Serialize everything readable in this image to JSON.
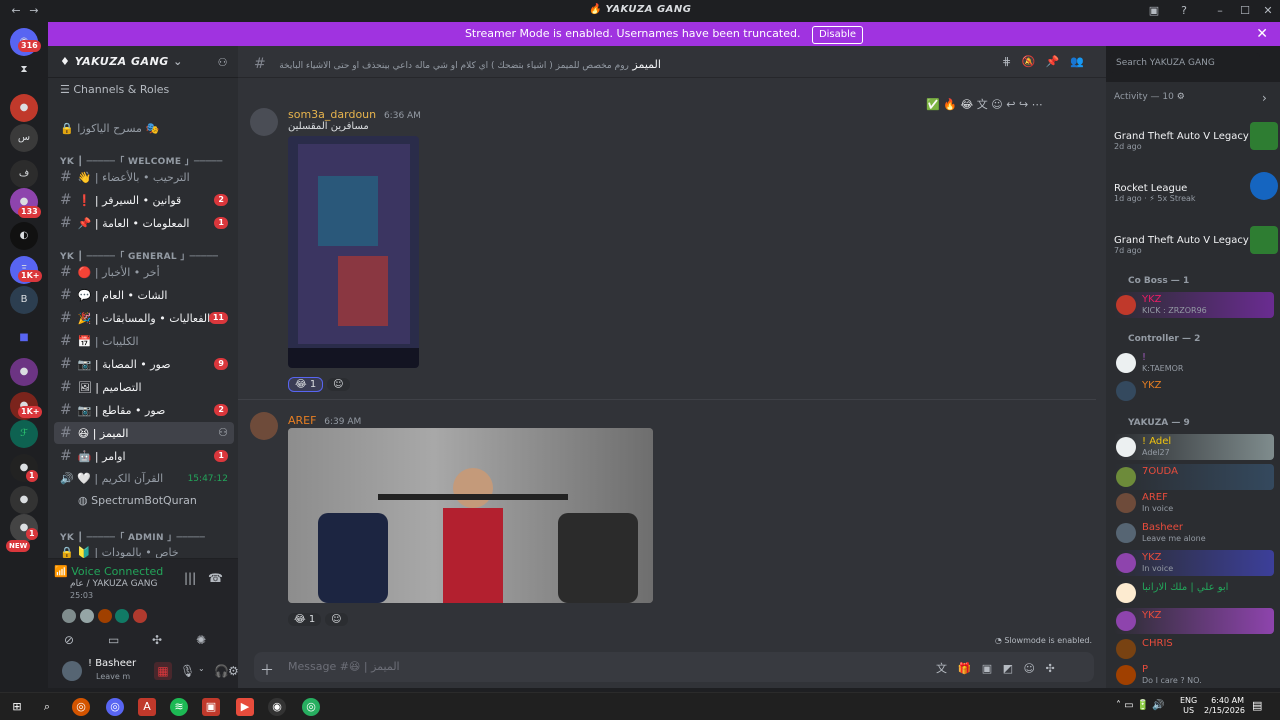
{
  "window": {
    "title": "YAKUZA GANG"
  },
  "banner": {
    "text": "Streamer Mode is enabled. Usernames have been truncated.",
    "button": "Disable"
  },
  "servers": {
    "badges": [
      "316",
      "133",
      "1K+",
      "1K+",
      "1",
      "1",
      "NEW"
    ]
  },
  "sidebar": {
    "guild_name": "YAKUZA GANG",
    "channels_roles": "Channels & Roles",
    "items": [
      {
        "label": "مسرح الياكوزا 🎭",
        "type": "stage"
      },
      {
        "label": "YK ┃ ─────「 WELCOME 」─────",
        "type": "category"
      },
      {
        "label": "👋 | الترحيب • بالأعضاء",
        "type": "text"
      },
      {
        "label": "❗ | قوانين • السيرفر",
        "type": "text",
        "badge": "2"
      },
      {
        "label": "📌 | المعلومات • العامة",
        "type": "text",
        "badge": "1"
      },
      {
        "label": "YK ┃ ─────「 GENERAL 」─────",
        "type": "category"
      },
      {
        "label": "🔴 | أخر • الأخبار",
        "type": "text"
      },
      {
        "label": "💬 | الشات • العام",
        "type": "text"
      },
      {
        "label": "🎉 | الفعاليات • والمسابقات",
        "type": "text",
        "badge": "11"
      },
      {
        "label": "📅 | الكليبات",
        "type": "text"
      },
      {
        "label": "📷 | صور • المصابة",
        "type": "text",
        "badge": "9"
      },
      {
        "label": "🖼 | التصاميم",
        "type": "text"
      },
      {
        "label": "📷 | صور • مقاطع",
        "type": "text",
        "badge": "2"
      },
      {
        "label": "😆 | الميمز",
        "type": "text",
        "active": true
      },
      {
        "label": "🤖 | اوامر",
        "type": "text",
        "badge": "1"
      },
      {
        "label": "🤍 | القرآن الكريم",
        "type": "voice",
        "time": "15:47:12"
      },
      {
        "label": "SpectrumBotQuran",
        "type": "voice-user"
      },
      {
        "label": "YK ┃ ─────「 ADMIN 」─────",
        "type": "category"
      },
      {
        "label": "🔰 | خاص • بالمودات",
        "type": "text"
      }
    ],
    "voice": {
      "status": "Voice Connected",
      "channel": "عام / YAKUZA GANG",
      "duration": "25:03"
    },
    "user": {
      "name": "! Basheer",
      "status": "Leave m"
    }
  },
  "channel": {
    "name": "الميمز",
    "topic": "روم مخصص للميمز ( اشياء بتضحك ) اي كلام او شي ماله داعي بينحذف او حتى الاشياء البايخة",
    "search_placeholder": "Search YAKUZA GANG"
  },
  "messages": [
    {
      "author": "som3a_dardoun",
      "time": "6:36 AM",
      "text": "مسافرين المقسلين",
      "reaction": "😂 1",
      "author_color": "#e6b34d"
    },
    {
      "author": "AREF",
      "time": "6:39 AM",
      "text": "",
      "reaction": "😂 1",
      "author_color": "#e67e22"
    }
  ],
  "composer": {
    "placeholder": "Message #😆 | الميمز",
    "slowmode": "Slowmode is enabled."
  },
  "members": {
    "activity_title": "Activity — 10",
    "activities": [
      {
        "game": "Grand Theft Auto V Legacy",
        "ago": "2d ago"
      },
      {
        "game": "Rocket League",
        "ago": "1d ago",
        "streak": "5x Streak"
      },
      {
        "game": "Grand Theft Auto V Legacy",
        "ago": "7d ago"
      }
    ],
    "groups": [
      {
        "title": "Co Boss — 1",
        "members": [
          {
            "name": "YKZ",
            "status": "KICK : ZRZOR96",
            "color": "#e91e63"
          }
        ]
      },
      {
        "title": "Controller — 2",
        "members": [
          {
            "name": "! ",
            "status": "K:TAEMOR",
            "color": "#9b59b6"
          },
          {
            "name": "YKZ",
            "status": "",
            "color": "#e67e22"
          }
        ]
      },
      {
        "title": "YAKUZA — 9",
        "members": [
          {
            "name": "! Adel",
            "status": "Adel27",
            "color": "#f1c40f"
          },
          {
            "name": "7OUDA",
            "status": "",
            "color": "#e74c3c"
          },
          {
            "name": "AREF",
            "status": "In voice",
            "color": "#e74c3c"
          },
          {
            "name": "Basheer",
            "status": "Leave me alone",
            "color": "#e74c3c"
          },
          {
            "name": "YKZ",
            "status": "In voice",
            "color": "#e74c3c"
          },
          {
            "name": "ابو علي | ملك الارانبا",
            "status": "",
            "color": "#e74c3c"
          },
          {
            "name": "YKZ",
            "status": "",
            "color": "#e74c3c"
          },
          {
            "name": "CHRIS",
            "status": "",
            "color": "#e74c3c"
          },
          {
            "name": "P",
            "status": "Do I care ? NO.",
            "color": "#e74c3c"
          }
        ]
      }
    ]
  },
  "taskbar": {
    "lang": "ENG",
    "region": "US",
    "time": "6:40 AM",
    "date": "2/15/2026"
  }
}
